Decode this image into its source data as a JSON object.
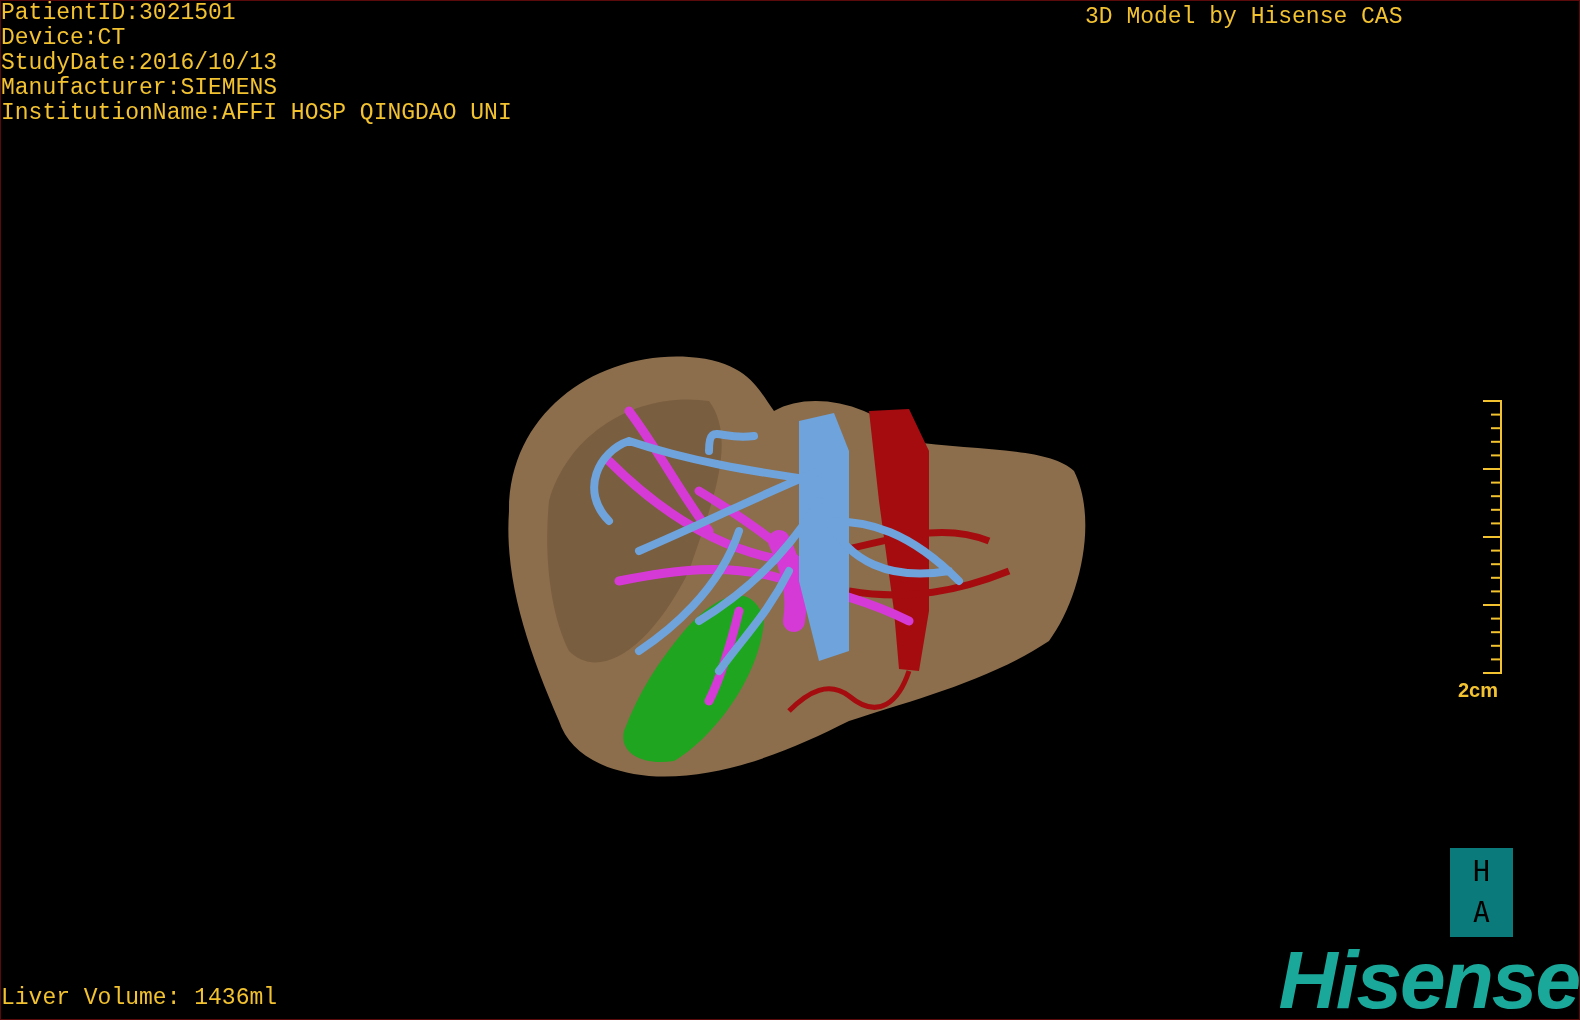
{
  "study_info": [
    "PatientID:3021501",
    "Device:CT",
    "StudyDate:2016/10/13",
    "Manufacturer:SIEMENS",
    "InstitutionName:AFFI HOSP QINGDAO UNI"
  ],
  "model_credit": "3D Model by Hisense CAS",
  "scale_bar": {
    "label": "2cm"
  },
  "orientation_marker": {
    "top": "H",
    "bottom": "A"
  },
  "liver_volume": "Liver Volume: 1436ml",
  "logo": "Hisense"
}
